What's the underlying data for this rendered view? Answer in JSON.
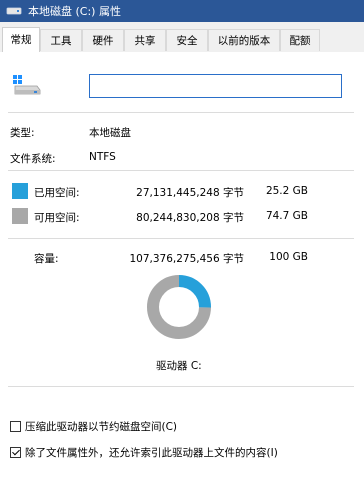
{
  "window": {
    "title": "本地磁盘 (C:) 属性"
  },
  "tabs": [
    {
      "label": "常规",
      "active": true
    },
    {
      "label": "工具"
    },
    {
      "label": "硬件"
    },
    {
      "label": "共享"
    },
    {
      "label": "安全"
    },
    {
      "label": "以前的版本"
    },
    {
      "label": "配额"
    }
  ],
  "drive": {
    "name_value": "",
    "icon": "drive-icon"
  },
  "info": {
    "type_label": "类型:",
    "type_value": "本地磁盘",
    "fs_label": "文件系统:",
    "fs_value": "NTFS"
  },
  "used": {
    "label": "已用空间:",
    "bytes": "27,131,445,248 字节",
    "size": "25.2 GB",
    "color": "#26a0da"
  },
  "free": {
    "label": "可用空间:",
    "bytes": "80,244,830,208 字节",
    "size": "74.7 GB",
    "color": "#a8a8a8"
  },
  "capacity": {
    "label": "容量:",
    "bytes": "107,376,275,456 字节",
    "size": "100 GB"
  },
  "chart_data": {
    "type": "pie",
    "categories": [
      "已用空间",
      "可用空间"
    ],
    "values": [
      25.2,
      74.7
    ],
    "colors": [
      "#26a0da",
      "#a8a8a8"
    ],
    "title": "驱动器 C:"
  },
  "options": {
    "compress_label": "压缩此驱动器以节约磁盘空间(C)",
    "compress_checked": false,
    "index_label": "除了文件属性外，还允许索引此驱动器上文件的内容(I)",
    "index_checked": true
  }
}
